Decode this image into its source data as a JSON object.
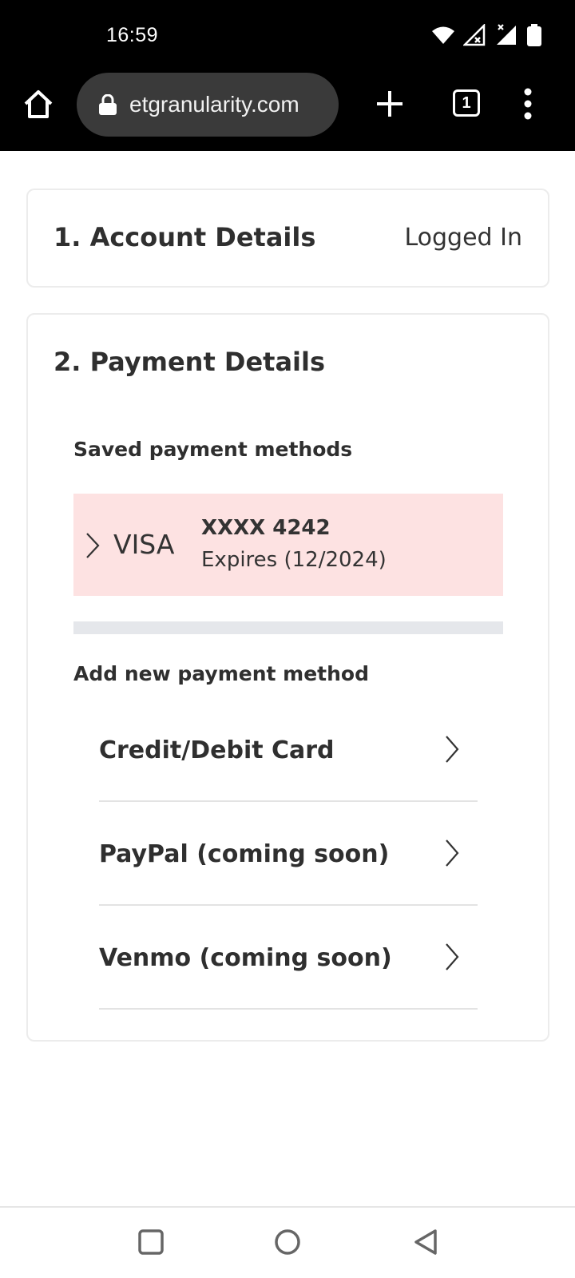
{
  "status_bar": {
    "time": "16:59",
    "icons": [
      "wifi-icon",
      "signal-x-icon",
      "signal-icon",
      "battery-icon"
    ]
  },
  "browser": {
    "url": "etgranularity.com",
    "tab_count": "1",
    "icons": [
      "home-icon",
      "lock-icon",
      "plus-icon",
      "tabs-icon",
      "menu-dots-icon"
    ]
  },
  "account_section": {
    "title": "1. Account Details",
    "status": "Logged In"
  },
  "payment_section": {
    "title": "2. Payment Details",
    "saved_label": "Saved payment methods",
    "saved_methods": [
      {
        "brand": "VISA",
        "number": "XXXX 4242",
        "expiry": "Expires (12/2024)"
      }
    ],
    "add_label": "Add new payment method",
    "new_methods": [
      {
        "label": "Credit/Debit Card"
      },
      {
        "label": "PayPal (coming soon)"
      },
      {
        "label": "Venmo (coming soon)"
      }
    ]
  },
  "colors": {
    "saved_card_bg": "#fde2e2",
    "top_bar": "#000000",
    "url_pill": "#3a3a3a"
  },
  "nav_bar": {
    "icons": [
      "recents-icon",
      "home-circle-icon",
      "back-icon"
    ]
  }
}
